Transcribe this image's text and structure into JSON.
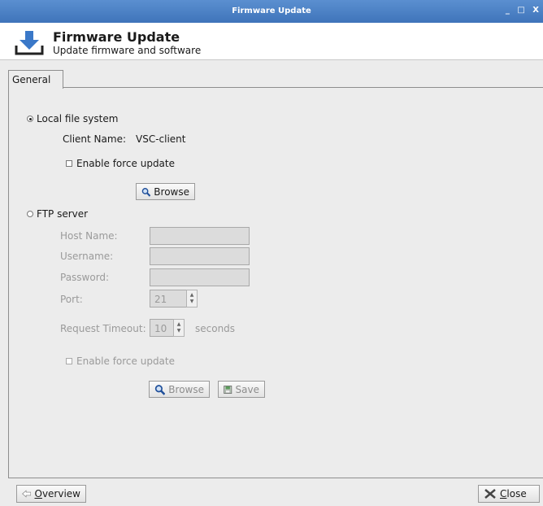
{
  "window": {
    "title": "Firmware Update",
    "controls": "_ □ X"
  },
  "header": {
    "title": "Firmware Update",
    "subtitle": "Update firmware and software"
  },
  "tabs": [
    {
      "label": "General",
      "selected": true
    }
  ],
  "local": {
    "label": "Local file system",
    "selected": true,
    "client_name_label": "Client Name:",
    "client_name_value": "VSC-client",
    "force_update_label": "Enable force update",
    "browse_label": "Browse"
  },
  "ftp": {
    "label": "FTP server",
    "selected": false,
    "host_label": "Host Name:",
    "host_value": "",
    "username_label": "Username:",
    "username_value": "",
    "password_label": "Password:",
    "password_value": "",
    "port_label": "Port:",
    "port_value": "21",
    "timeout_label": "Request Timeout:",
    "timeout_value": "10",
    "timeout_unit": "seconds",
    "force_update_label": "Enable force update",
    "browse_label": "Browse",
    "save_label": "Save"
  },
  "footer": {
    "overview_prefix": "",
    "overview_mnemonic": "O",
    "overview_rest": "verview",
    "close_mnemonic": "C",
    "close_rest": "lose"
  },
  "colors": {
    "titlebar": "#4a80c4",
    "disabled_text": "#9a9a9a",
    "header_icon": "#3a78c8"
  }
}
